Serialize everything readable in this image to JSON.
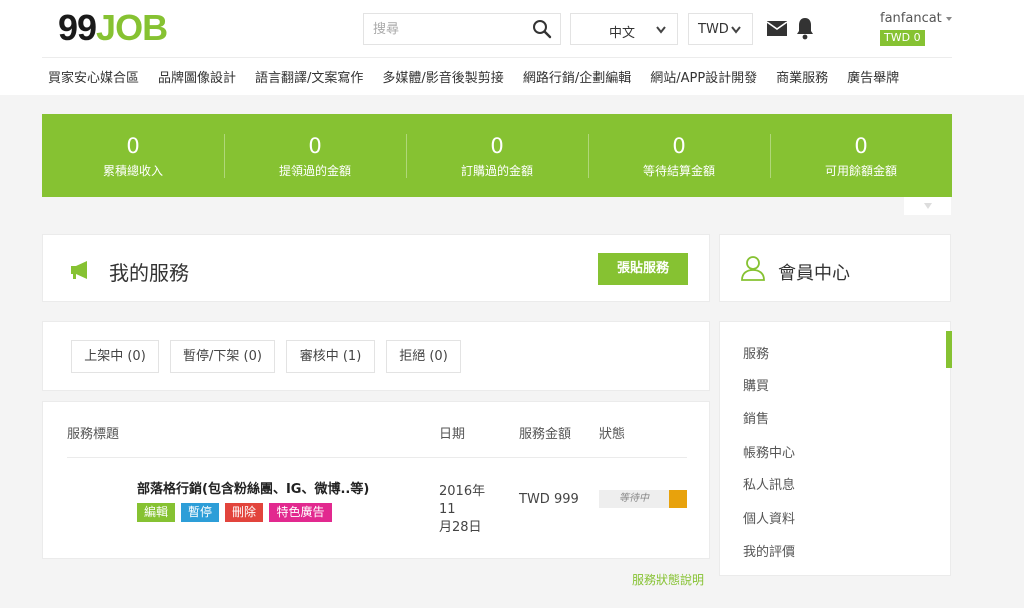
{
  "header": {
    "logo_num": "99",
    "logo_word": "JOB",
    "search_placeholder": "搜尋",
    "language": "中文",
    "currency": "TWD",
    "username": "fanfancat",
    "balance": "TWD 0"
  },
  "nav": [
    "買家安心媒合區",
    "品牌圖像設計",
    "語言翻譯/文案寫作",
    "多媒體/影音後製剪接",
    "網路行銷/企劃編輯",
    "網站/APP設計開發",
    "商業服務",
    "廣告舉牌"
  ],
  "stats": [
    {
      "value": "0",
      "label": "累積總收入"
    },
    {
      "value": "0",
      "label": "提領過的金額"
    },
    {
      "value": "0",
      "label": "訂購過的金額"
    },
    {
      "value": "0",
      "label": "等待結算金額"
    },
    {
      "value": "0",
      "label": "可用餘額金額"
    }
  ],
  "services": {
    "title": "我的服務",
    "post_button": "張貼服務",
    "filters": [
      "上架中 (0)",
      "暫停/下架 (0)",
      "審核中 (1)",
      "拒絕 (0)"
    ],
    "columns": {
      "title": "服務標題",
      "date": "日期",
      "amount": "服務金額",
      "status": "狀態"
    },
    "row": {
      "title": "部落格行銷(包含粉絲團、IG、微博..等)",
      "actions": [
        "編輯",
        "暫停",
        "刪除",
        "特色廣告"
      ],
      "date_line1": "2016年11",
      "date_line2": "月28日",
      "amount": "TWD 999",
      "status": "等待中"
    },
    "legend_link": "服務狀態說明"
  },
  "member": {
    "title": "會員中心",
    "menu": [
      "服務",
      "購買",
      "銷售",
      "帳務中心",
      "私人訊息",
      "個人資料",
      "我的評價"
    ]
  },
  "colors": {
    "brand": "#86c232",
    "action_edit": "#86c232",
    "action_pause": "#2d9ed8",
    "action_delete": "#e2443c",
    "action_featured": "#e2298f",
    "status_pending": "#e8a20c"
  }
}
